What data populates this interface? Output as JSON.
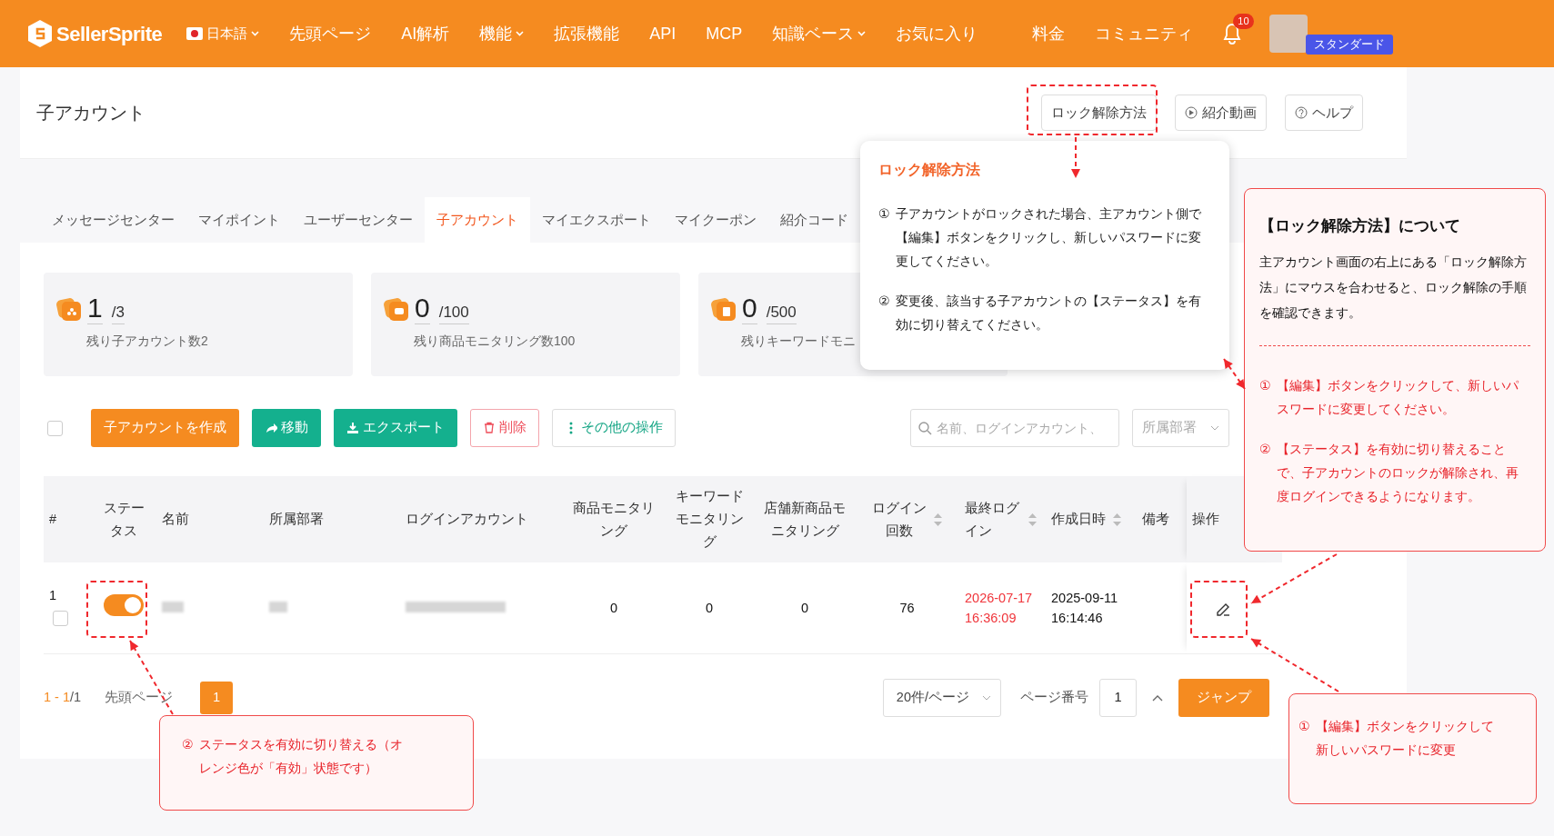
{
  "navbar": {
    "logo": "SellerSprite",
    "language": "日本語",
    "items": [
      {
        "label": "先頭ページ",
        "dropdown": false
      },
      {
        "label": "AI解析",
        "dropdown": false
      },
      {
        "label": "機能",
        "dropdown": true
      },
      {
        "label": "拡張機能",
        "dropdown": false
      },
      {
        "label": "API",
        "dropdown": false
      },
      {
        "label": "MCP",
        "dropdown": false
      },
      {
        "label": "知識ベース",
        "dropdown": true
      },
      {
        "label": "お気に入り",
        "dropdown": false
      }
    ],
    "right_items": [
      {
        "label": "料金"
      },
      {
        "label": "コミュニティ"
      }
    ],
    "notifications": "10",
    "plan_badge": "スタンダード"
  },
  "page": {
    "title": "子アカウント",
    "header_buttons": [
      {
        "label": "ロック解除方法"
      },
      {
        "label": "紹介動画"
      },
      {
        "label": "ヘルプ"
      }
    ]
  },
  "tabs": [
    {
      "label": "メッセージセンター",
      "selected": false
    },
    {
      "label": "マイポイント",
      "selected": false
    },
    {
      "label": "ユーザーセンター",
      "selected": false
    },
    {
      "label": "子アカウント",
      "selected": true
    },
    {
      "label": "マイエクスポート",
      "selected": false
    },
    {
      "label": "マイクーポン",
      "selected": false
    },
    {
      "label": "紹介コード",
      "selected": false
    }
  ],
  "stats": [
    {
      "value": "1",
      "total": "/3",
      "caption": "残り子アカウント数2"
    },
    {
      "value": "0",
      "total": "/100",
      "caption": "残り商品モニタリング数100"
    },
    {
      "value": "0",
      "total": "/500",
      "caption": "残りキーワードモニ"
    }
  ],
  "toolbar": {
    "select_all_checked": false,
    "buttons": [
      {
        "label": "子アカウントを作成",
        "kind": "primary"
      },
      {
        "label": "移動",
        "kind": "teal"
      },
      {
        "label": "エクスポート",
        "kind": "teal"
      },
      {
        "label": "削除",
        "kind": "danger"
      },
      {
        "label": "その他の操作",
        "kind": "outline"
      }
    ],
    "search_placeholder": "名前、ログインアカウント、",
    "department_placeholder": "所属部署"
  },
  "table": {
    "columns": [
      {
        "label": "#",
        "sortable": false
      },
      {
        "label": "ステータス",
        "sortable": false
      },
      {
        "label": "名前",
        "sortable": false
      },
      {
        "label": "所属部署",
        "sortable": false
      },
      {
        "label": "ログインアカウント",
        "sortable": false
      },
      {
        "label": "商品モニタリング",
        "sortable": false
      },
      {
        "label": "キーワードモニタリング",
        "sortable": false
      },
      {
        "label": "店舗新商品モニタリング",
        "sortable": false
      },
      {
        "label": "ログイン回数",
        "sortable": true
      },
      {
        "label": "最終ログイン",
        "sortable": true
      },
      {
        "label": "作成日時",
        "sortable": true
      },
      {
        "label": "備考",
        "sortable": false
      },
      {
        "label": "操作",
        "sortable": false
      }
    ],
    "rows": [
      {
        "index": "1",
        "checked": false,
        "enabled": true,
        "product_monitoring": "0",
        "keyword_monitoring": "0",
        "store_monitoring": "0",
        "login_count": "76",
        "last_login": "2026-07-17 16:36:09",
        "last_login_alert": true,
        "created": "2025-09-11 16:14:46"
      }
    ]
  },
  "pagination": {
    "range": "1 - 1",
    "total": "/1",
    "first_page": "先頭ページ",
    "pages": [
      {
        "label": "1",
        "selected": true
      }
    ],
    "page_size": "20件/ページ",
    "page_number_label": "ページ番号",
    "page_input": "1",
    "jump": "ジャンプ"
  },
  "popover": {
    "title": "ロック解除方法",
    "steps": [
      {
        "number": "①",
        "text": "子アカウントがロックされた場合、主アカウント側で【編集】ボタンをクリックし、新しいパスワードに変更してください。"
      },
      {
        "number": "②",
        "text": "変更後、該当する子アカウントの【ステータス】を有効に切り替えてください。"
      }
    ]
  },
  "callouts": [
    {
      "title": "【ロック解除方法】について",
      "body": "主アカウント画面の右上にある「ロック解除方法」にマウスを合わせると、ロック解除の手順を確認できます。",
      "steps": [
        {
          "number": "①",
          "text": "【編集】ボタンをクリックして、新しいパスワードに変更してください。"
        },
        {
          "number": "②",
          "text": "【ステータス】を有効に切り替えることで、子アカウントのロックが解除され、再度ログインできるようになります。"
        }
      ]
    },
    {
      "steps": [
        {
          "number": "②",
          "text": "ステータスを有効に切り替える（オレンジ色が「有効」状態です）"
        }
      ]
    },
    {
      "steps": [
        {
          "number": "①",
          "text": "【編集】ボタンをクリックして新しいパスワードに変更"
        }
      ]
    }
  ]
}
